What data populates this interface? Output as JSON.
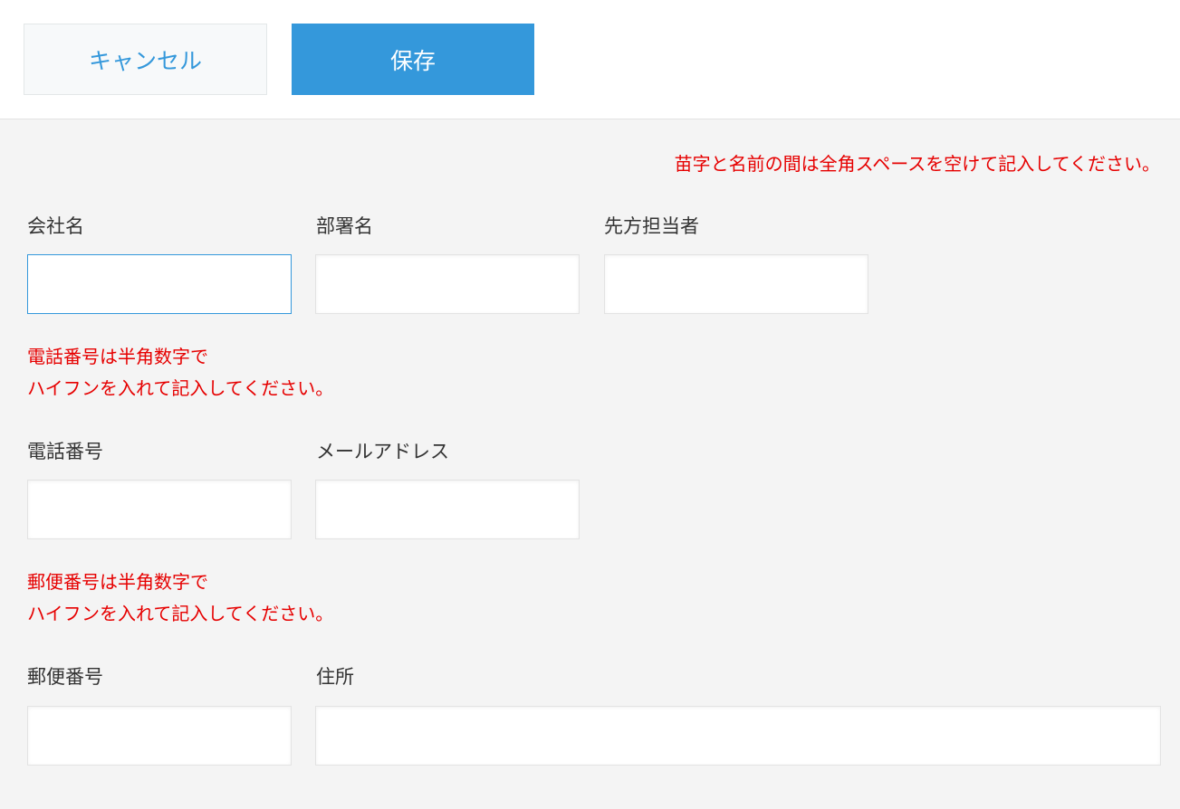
{
  "toolbar": {
    "cancel_label": "キャンセル",
    "save_label": "保存"
  },
  "notices": {
    "name_format": "苗字と名前の間は全角スペースを空けて記入してください。",
    "phone_line1": "電話番号は半角数字で",
    "phone_line2": "ハイフンを入れて記入してください。",
    "postal_line1": "郵便番号は半角数字で",
    "postal_line2": "ハイフンを入れて記入してください。"
  },
  "form": {
    "company_label": "会社名",
    "company_value": "",
    "department_label": "部署名",
    "department_value": "",
    "contact_label": "先方担当者",
    "contact_value": "",
    "phone_label": "電話番号",
    "phone_value": "",
    "email_label": "メールアドレス",
    "email_value": "",
    "postal_label": "郵便番号",
    "postal_value": "",
    "address_label": "住所",
    "address_value": ""
  },
  "colors": {
    "accent": "#3498db",
    "notice": "#e60000",
    "page_background": "#f4f4f4"
  }
}
